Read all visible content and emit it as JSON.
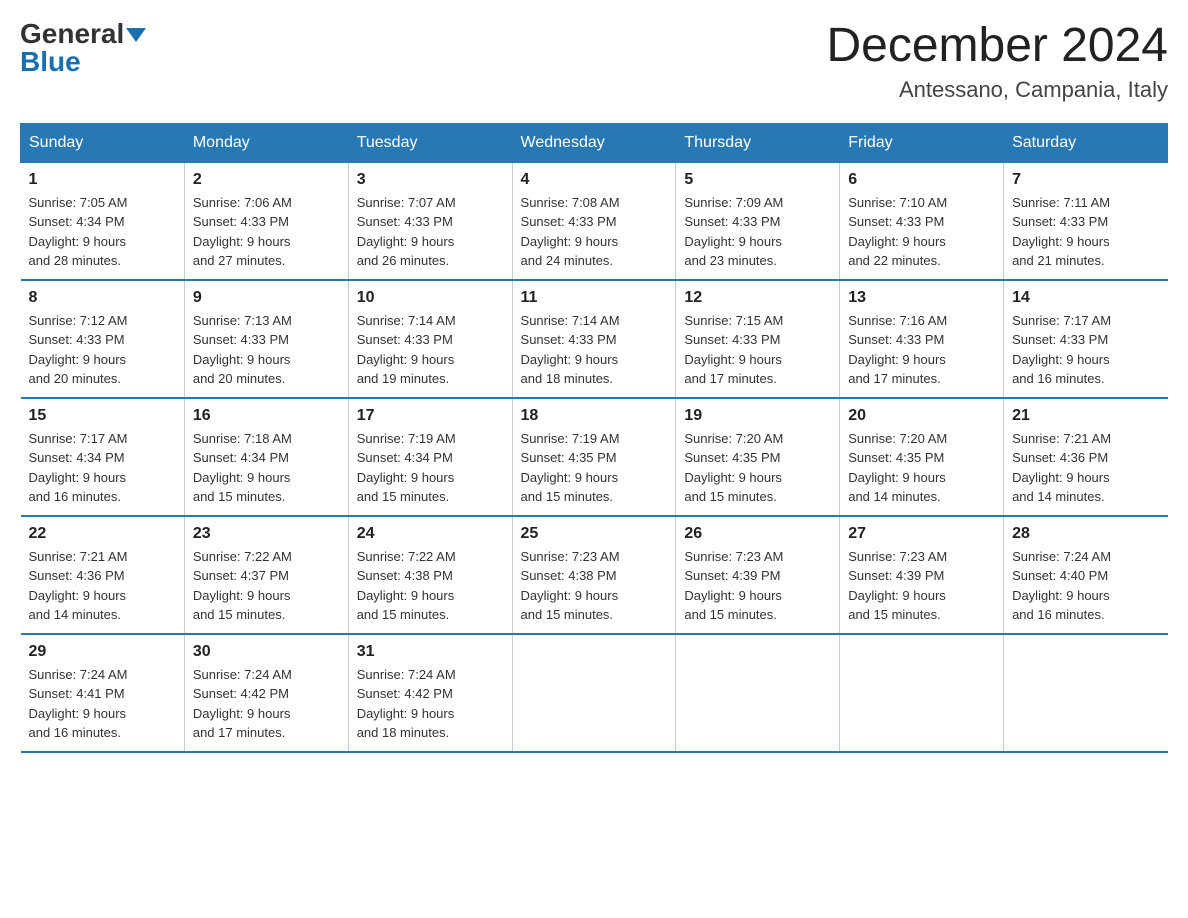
{
  "header": {
    "logo_general": "General",
    "logo_blue": "Blue",
    "month_year": "December 2024",
    "location": "Antessano, Campania, Italy"
  },
  "days_of_week": [
    "Sunday",
    "Monday",
    "Tuesday",
    "Wednesday",
    "Thursday",
    "Friday",
    "Saturday"
  ],
  "weeks": [
    [
      {
        "day": "1",
        "sunrise": "7:05 AM",
        "sunset": "4:34 PM",
        "daylight": "9 hours and 28 minutes."
      },
      {
        "day": "2",
        "sunrise": "7:06 AM",
        "sunset": "4:33 PM",
        "daylight": "9 hours and 27 minutes."
      },
      {
        "day": "3",
        "sunrise": "7:07 AM",
        "sunset": "4:33 PM",
        "daylight": "9 hours and 26 minutes."
      },
      {
        "day": "4",
        "sunrise": "7:08 AM",
        "sunset": "4:33 PM",
        "daylight": "9 hours and 24 minutes."
      },
      {
        "day": "5",
        "sunrise": "7:09 AM",
        "sunset": "4:33 PM",
        "daylight": "9 hours and 23 minutes."
      },
      {
        "day": "6",
        "sunrise": "7:10 AM",
        "sunset": "4:33 PM",
        "daylight": "9 hours and 22 minutes."
      },
      {
        "day": "7",
        "sunrise": "7:11 AM",
        "sunset": "4:33 PM",
        "daylight": "9 hours and 21 minutes."
      }
    ],
    [
      {
        "day": "8",
        "sunrise": "7:12 AM",
        "sunset": "4:33 PM",
        "daylight": "9 hours and 20 minutes."
      },
      {
        "day": "9",
        "sunrise": "7:13 AM",
        "sunset": "4:33 PM",
        "daylight": "9 hours and 20 minutes."
      },
      {
        "day": "10",
        "sunrise": "7:14 AM",
        "sunset": "4:33 PM",
        "daylight": "9 hours and 19 minutes."
      },
      {
        "day": "11",
        "sunrise": "7:14 AM",
        "sunset": "4:33 PM",
        "daylight": "9 hours and 18 minutes."
      },
      {
        "day": "12",
        "sunrise": "7:15 AM",
        "sunset": "4:33 PM",
        "daylight": "9 hours and 17 minutes."
      },
      {
        "day": "13",
        "sunrise": "7:16 AM",
        "sunset": "4:33 PM",
        "daylight": "9 hours and 17 minutes."
      },
      {
        "day": "14",
        "sunrise": "7:17 AM",
        "sunset": "4:33 PM",
        "daylight": "9 hours and 16 minutes."
      }
    ],
    [
      {
        "day": "15",
        "sunrise": "7:17 AM",
        "sunset": "4:34 PM",
        "daylight": "9 hours and 16 minutes."
      },
      {
        "day": "16",
        "sunrise": "7:18 AM",
        "sunset": "4:34 PM",
        "daylight": "9 hours and 15 minutes."
      },
      {
        "day": "17",
        "sunrise": "7:19 AM",
        "sunset": "4:34 PM",
        "daylight": "9 hours and 15 minutes."
      },
      {
        "day": "18",
        "sunrise": "7:19 AM",
        "sunset": "4:35 PM",
        "daylight": "9 hours and 15 minutes."
      },
      {
        "day": "19",
        "sunrise": "7:20 AM",
        "sunset": "4:35 PM",
        "daylight": "9 hours and 15 minutes."
      },
      {
        "day": "20",
        "sunrise": "7:20 AM",
        "sunset": "4:35 PM",
        "daylight": "9 hours and 14 minutes."
      },
      {
        "day": "21",
        "sunrise": "7:21 AM",
        "sunset": "4:36 PM",
        "daylight": "9 hours and 14 minutes."
      }
    ],
    [
      {
        "day": "22",
        "sunrise": "7:21 AM",
        "sunset": "4:36 PM",
        "daylight": "9 hours and 14 minutes."
      },
      {
        "day": "23",
        "sunrise": "7:22 AM",
        "sunset": "4:37 PM",
        "daylight": "9 hours and 15 minutes."
      },
      {
        "day": "24",
        "sunrise": "7:22 AM",
        "sunset": "4:38 PM",
        "daylight": "9 hours and 15 minutes."
      },
      {
        "day": "25",
        "sunrise": "7:23 AM",
        "sunset": "4:38 PM",
        "daylight": "9 hours and 15 minutes."
      },
      {
        "day": "26",
        "sunrise": "7:23 AM",
        "sunset": "4:39 PM",
        "daylight": "9 hours and 15 minutes."
      },
      {
        "day": "27",
        "sunrise": "7:23 AM",
        "sunset": "4:39 PM",
        "daylight": "9 hours and 15 minutes."
      },
      {
        "day": "28",
        "sunrise": "7:24 AM",
        "sunset": "4:40 PM",
        "daylight": "9 hours and 16 minutes."
      }
    ],
    [
      {
        "day": "29",
        "sunrise": "7:24 AM",
        "sunset": "4:41 PM",
        "daylight": "9 hours and 16 minutes."
      },
      {
        "day": "30",
        "sunrise": "7:24 AM",
        "sunset": "4:42 PM",
        "daylight": "9 hours and 17 minutes."
      },
      {
        "day": "31",
        "sunrise": "7:24 AM",
        "sunset": "4:42 PM",
        "daylight": "9 hours and 18 minutes."
      },
      null,
      null,
      null,
      null
    ]
  ],
  "labels": {
    "sunrise": "Sunrise: ",
    "sunset": "Sunset: ",
    "daylight": "Daylight: "
  }
}
